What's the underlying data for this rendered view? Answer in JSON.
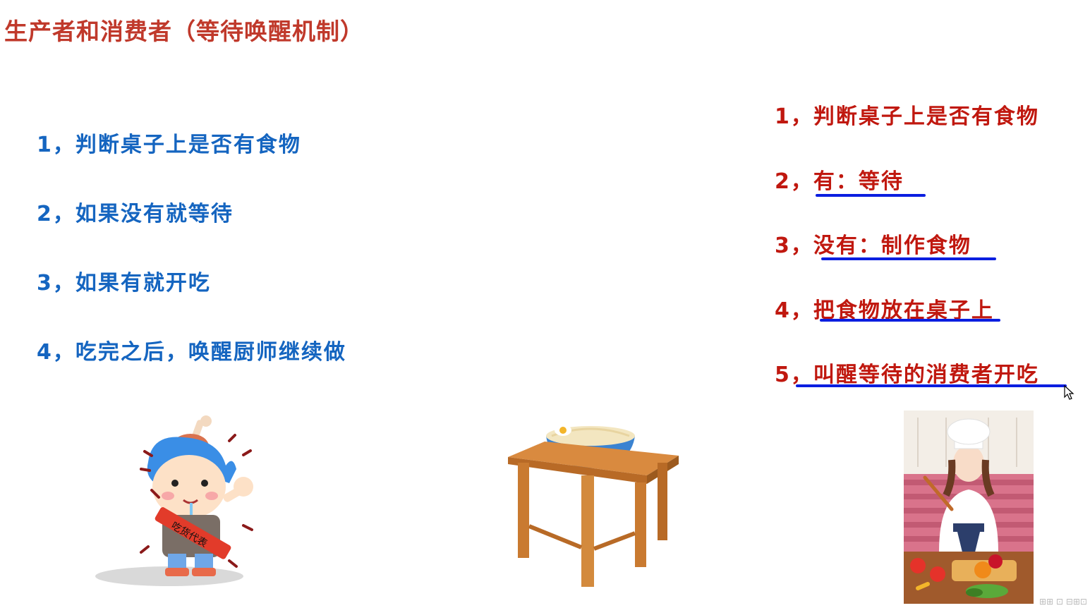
{
  "title": "生产者和消费者（等待唤醒机制）",
  "consumer_steps": [
    "1，判断桌子上是否有食物",
    "2，如果没有就等待",
    "3，如果有就开吃",
    "4，吃完之后，唤醒厨师继续做"
  ],
  "producer_steps": [
    "1，判断桌子上是否有食物",
    "2，有：等待",
    "3，没有：制作食物",
    "4，把食物放在桌子上",
    "5，叫醒等待的消费者开吃"
  ],
  "banner_text": "吃货代表",
  "colors": {
    "title": "#c0392b",
    "consumer_text": "#1565c0",
    "producer_text": "#c0180f",
    "underline": "#0a1ee0"
  }
}
